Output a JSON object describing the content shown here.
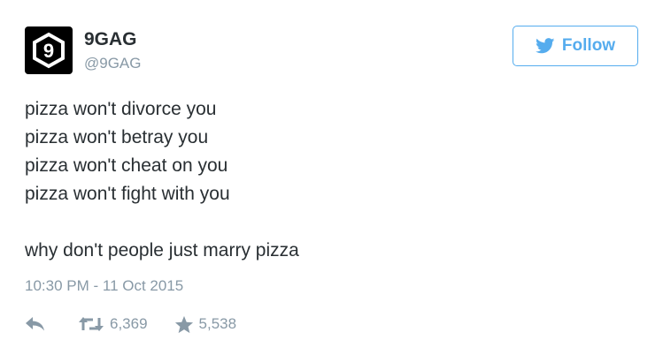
{
  "user": {
    "name": "9GAG",
    "handle": "@9GAG",
    "avatar_icon": "9gag-logo-icon",
    "avatar_glyph": "9"
  },
  "follow_button": {
    "label": "Follow",
    "icon": "twitter-bird-icon"
  },
  "tweet": {
    "lines": [
      "pizza won't divorce you",
      "pizza won't betray you",
      "pizza won't cheat on you",
      "pizza won't fight with you"
    ],
    "closing_line": "why don't people just marry pizza",
    "timestamp": "10:30 PM - 11 Oct 2015"
  },
  "actions": {
    "reply_icon": "reply-icon",
    "retweet_icon": "retweet-icon",
    "retweet_count": "6,369",
    "favorite_icon": "star-icon",
    "favorite_count": "5,538"
  },
  "colors": {
    "accent": "#55acee",
    "muted": "#8899a6",
    "text": "#292f33"
  }
}
